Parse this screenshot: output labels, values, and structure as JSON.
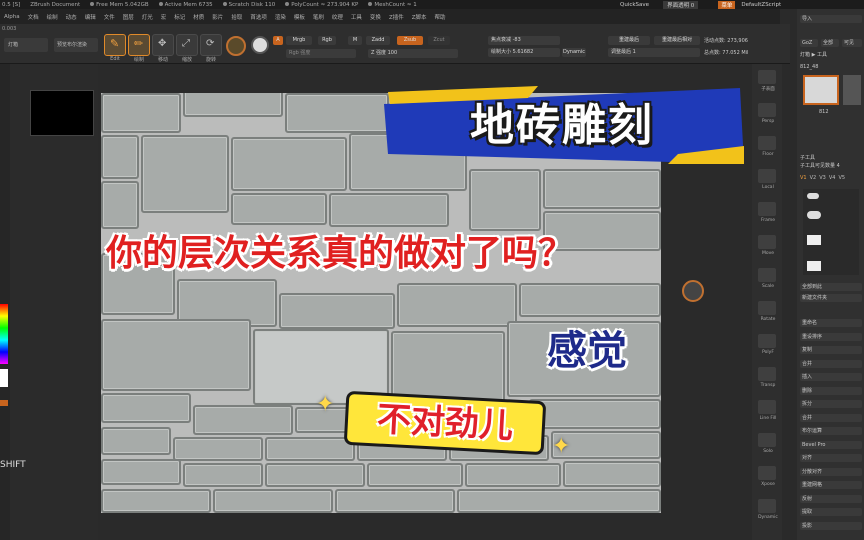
{
  "topbar": {
    "left_text": "0.5 [S]",
    "document": "ZBrush Document",
    "free_mem": "Free Mem 5.042GB",
    "active_mem": "Active Mem 6735",
    "scratch_disk": "Scratch Disk 110",
    "poly_count": "PolyCount ≈ 273.904 KP",
    "mesh_count": "MeshCount ≈ 1",
    "quicksave": "QuickSave",
    "transparency": "界面透明 0",
    "menus_btn": "菜单",
    "default_script": "DefaultZScript"
  },
  "menu_items": [
    "Alpha",
    "文档",
    "绘制",
    "动态",
    "编辑",
    "文件",
    "图层",
    "灯光",
    "宏",
    "标记",
    "材质",
    "影片",
    "拾取",
    "首选项",
    "渲染",
    "模板",
    "笔刷",
    "纹理",
    "工具",
    "变换",
    "Z插件",
    "Z脚本",
    "帮助"
  ],
  "subbar": {
    "value": "0.003"
  },
  "shelf": {
    "lightbox_label": "灯箱",
    "preview_label": "预览布尔渲染",
    "edit_label": "Edit",
    "draw_label": "绘制",
    "move_label": "移动",
    "scale_label": "缩放",
    "rotate_label": "旋转",
    "mrgb": "Mrgb",
    "rgb": "Rgb",
    "m": "M",
    "zadd": "Zadd",
    "zsub": "Zsub",
    "zcut": "Zcut",
    "a_label": "A",
    "rgb_intensity": "Rgb 强度",
    "z_intensity": "Z 强度 100",
    "focal_shift": "焦点衰减 -83",
    "draw_size": "绘制大小 5.61682",
    "dynamic": "Dynamic",
    "active_points": "活动点数: 273,906",
    "total_points": "总点数: 77.052 Mil",
    "resetdiv": "重建最后",
    "resetdiv2": "重建最后相对",
    "adjust": "调整最后 1"
  },
  "right_dock": [
    "子表面",
    "Persp",
    "Floor",
    "Local",
    "Frame",
    "Move",
    "Scale",
    "Rotate",
    "PolyF",
    "Transp",
    "Line Fill",
    "Solo",
    "Xpose",
    "Dynamic"
  ],
  "right_panel": {
    "import": "导入",
    "goz": "GoZ",
    "all": "全部",
    "visible": "可见",
    "lightbox_tools": "灯箱 ▶ 工具",
    "tool_name": "812_48",
    "thumb_count": "812",
    "subtool_header": "子工具",
    "subtool_count": "子工具可见数量 4",
    "v_tabs": [
      "V1",
      "V2",
      "V3",
      "V4",
      "V5"
    ],
    "list_all": "全部到此",
    "new_folder": "新建文件夹",
    "rows": [
      "重命名",
      "重设排序",
      "复制",
      "合并",
      "插入",
      "删除",
      "拆分",
      "合并",
      "布尔运算",
      "Bevel Pro",
      "对齐",
      "分散对齐",
      "重建网格",
      "反射",
      "提取",
      "投影"
    ]
  },
  "overlay": {
    "title": "地砖雕刻",
    "question": "你的层次关系真的做对了吗？",
    "feeling": "感觉",
    "wrong": "不对劲儿"
  },
  "shift_label": "SHIFT"
}
